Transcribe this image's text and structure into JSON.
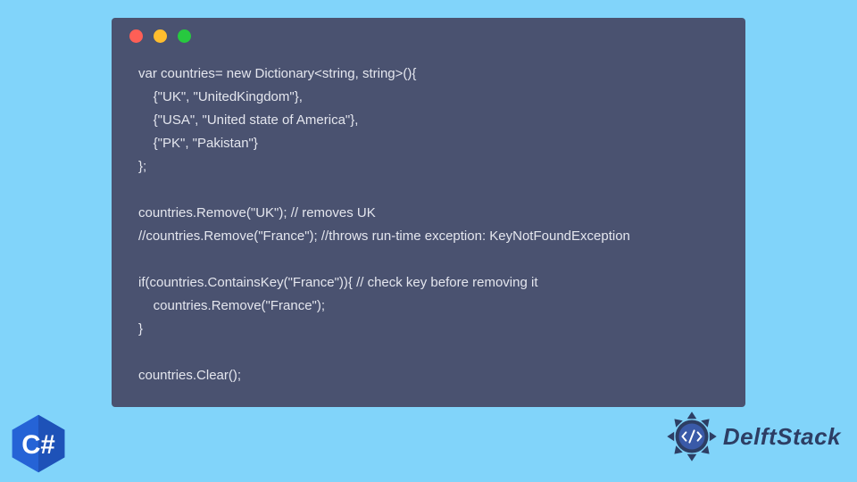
{
  "code": {
    "lines": [
      "var countries= new Dictionary<string, string>(){",
      "    {\"UK\", \"UnitedKingdom\"},",
      "    {\"USA\", \"United state of America\"},",
      "    {\"PK\", \"Pakistan\"}",
      "};",
      "",
      "countries.Remove(\"UK\"); // removes UK",
      "//countries.Remove(\"France\"); //throws run-time exception: KeyNotFoundException",
      "",
      "if(countries.ContainsKey(\"France\")){ // check key before removing it",
      "    countries.Remove(\"France\");",
      "}",
      "",
      "countries.Clear();"
    ]
  },
  "badge": {
    "label": "C#"
  },
  "brand": {
    "name": "DelftStack"
  },
  "colors": {
    "bg": "#81d4fa",
    "window": "#4a5270",
    "text": "#e4e6ee",
    "badge": "#2563d6",
    "brand": "#2d3e64"
  }
}
